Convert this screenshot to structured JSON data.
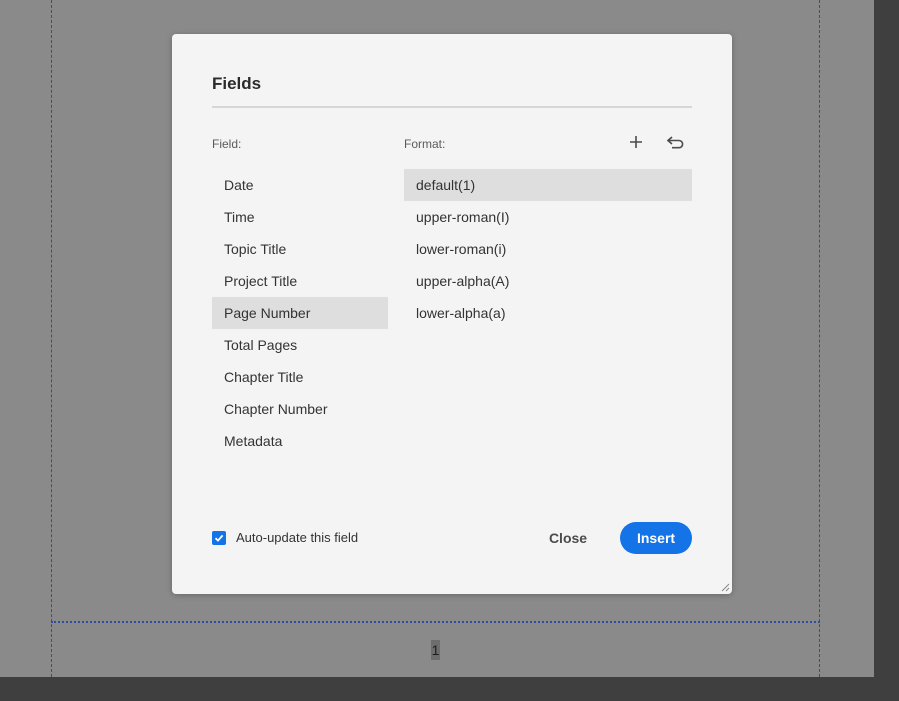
{
  "dialog": {
    "title": "Fields",
    "field_label": "Field:",
    "format_label": "Format:",
    "fields": [
      {
        "label": "Date",
        "selected": false
      },
      {
        "label": "Time",
        "selected": false
      },
      {
        "label": "Topic Title",
        "selected": false
      },
      {
        "label": "Project Title",
        "selected": false
      },
      {
        "label": "Page Number",
        "selected": true
      },
      {
        "label": "Total Pages",
        "selected": false
      },
      {
        "label": "Chapter Title",
        "selected": false
      },
      {
        "label": "Chapter Number",
        "selected": false
      },
      {
        "label": "Metadata",
        "selected": false
      }
    ],
    "formats": [
      {
        "label": "default(1)",
        "selected": true
      },
      {
        "label": "upper-roman(I)",
        "selected": false
      },
      {
        "label": "lower-roman(i)",
        "selected": false
      },
      {
        "label": "upper-alpha(A)",
        "selected": false
      },
      {
        "label": "lower-alpha(a)",
        "selected": false
      }
    ],
    "auto_update_label": "Auto-update this field",
    "auto_update_checked": true,
    "close_label": "Close",
    "insert_label": "Insert",
    "add_icon": "plus-icon",
    "reset_icon": "undo-icon"
  },
  "page": {
    "number_text": "1"
  },
  "colors": {
    "accent": "#1473e6",
    "overlay": "#8a8a8a",
    "dialog_bg": "#f4f4f4",
    "selected_row": "#dedede",
    "guide": "#2c4f9f"
  }
}
